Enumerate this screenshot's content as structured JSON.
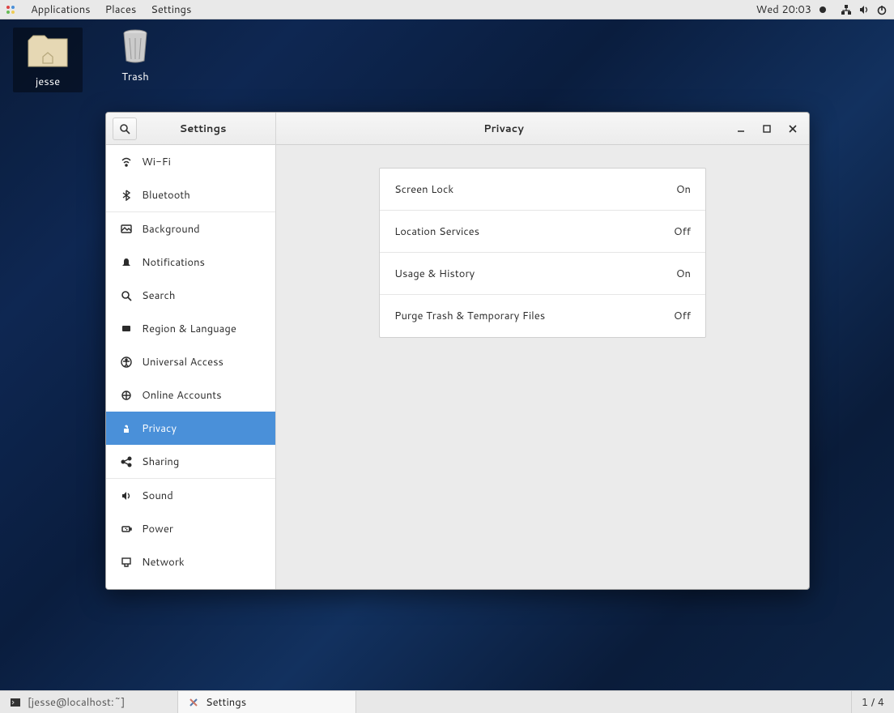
{
  "topbar": {
    "menus": [
      "Applications",
      "Places",
      "Settings"
    ],
    "clock": "Wed 20:03"
  },
  "desktop": {
    "home_label": "jesse",
    "trash_label": "Trash"
  },
  "window": {
    "sidebar_title": "Settings",
    "content_title": "Privacy",
    "sidebar_items": [
      {
        "id": "wifi",
        "label": "Wi-Fi"
      },
      {
        "id": "bluetooth",
        "label": "Bluetooth"
      },
      {
        "id": "background",
        "label": "Background"
      },
      {
        "id": "notifications",
        "label": "Notifications"
      },
      {
        "id": "search",
        "label": "Search"
      },
      {
        "id": "region",
        "label": "Region & Language"
      },
      {
        "id": "universal",
        "label": "Universal Access"
      },
      {
        "id": "online",
        "label": "Online Accounts"
      },
      {
        "id": "privacy",
        "label": "Privacy"
      },
      {
        "id": "sharing",
        "label": "Sharing"
      },
      {
        "id": "sound",
        "label": "Sound"
      },
      {
        "id": "power",
        "label": "Power"
      },
      {
        "id": "network",
        "label": "Network"
      }
    ],
    "privacy_rows": [
      {
        "label": "Screen Lock",
        "value": "On"
      },
      {
        "label": "Location Services",
        "value": "Off"
      },
      {
        "label": "Usage & History",
        "value": "On"
      },
      {
        "label": "Purge Trash & Temporary Files",
        "value": "Off"
      }
    ]
  },
  "taskbar": {
    "tasks": [
      {
        "label": "[jesse@localhost:~]",
        "active": false
      },
      {
        "label": "Settings",
        "active": true
      }
    ],
    "workspace": "1 / 4"
  }
}
